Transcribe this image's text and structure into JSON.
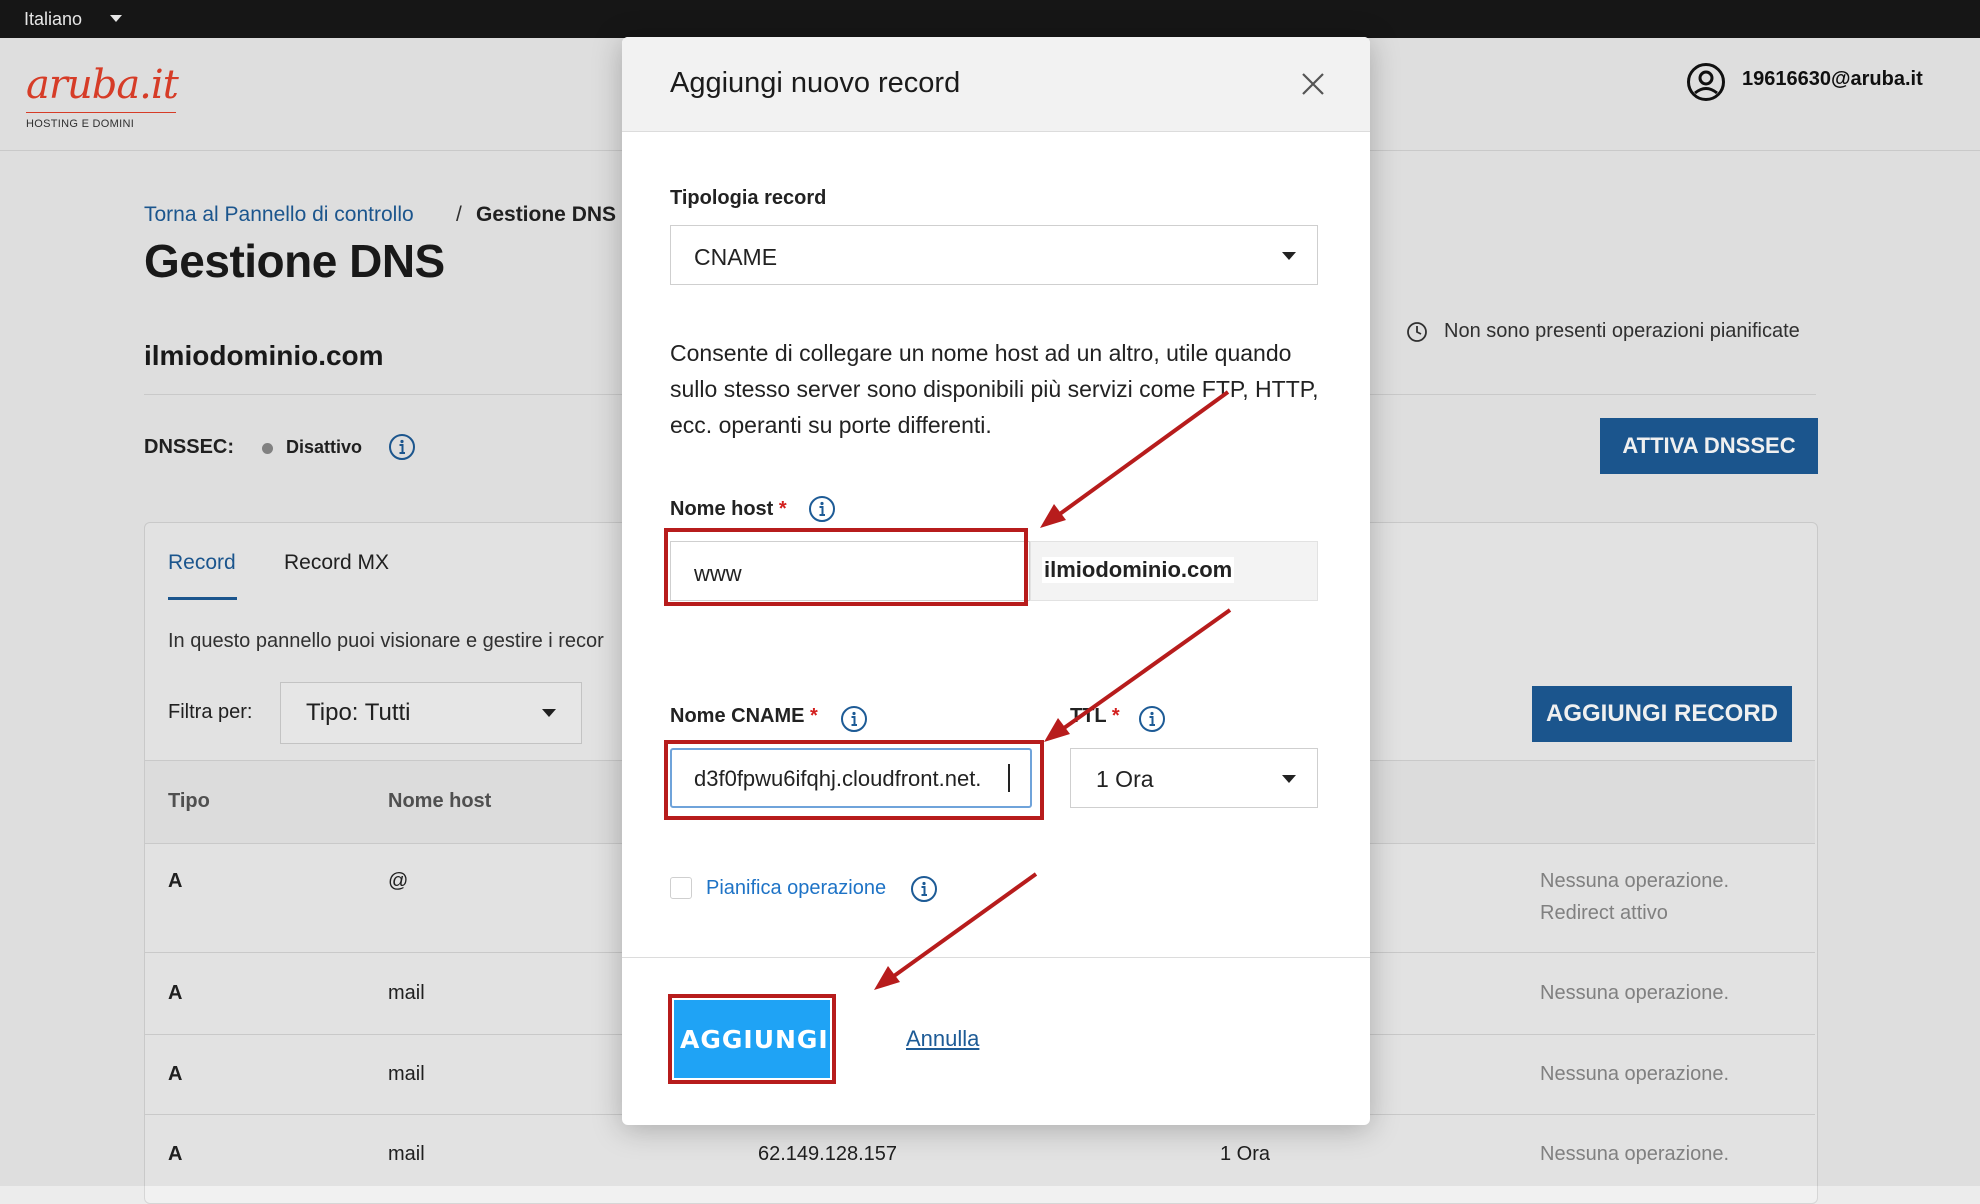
{
  "topbar": {
    "language": "Italiano"
  },
  "header": {
    "logo_text": "aruba.it",
    "logo_sub": "HOSTING E DOMINI",
    "user_email": "19616630@aruba.it"
  },
  "page": {
    "breadcrumb_link": "Torna al Pannello di controllo",
    "breadcrumb_sep": "/",
    "breadcrumb_current": "Gestione DNS",
    "title": "Gestione DNS",
    "domain": "ilmiodominio.com",
    "scheduled_text": "Non sono presenti operazioni pianificate",
    "dnssec_label": "DNSSEC:",
    "dnssec_status": "Disattivo",
    "activate_dnssec": "ATTIVA DNSSEC"
  },
  "panel": {
    "tabs": [
      {
        "label": "Record"
      },
      {
        "label": "Record MX"
      }
    ],
    "description": "In questo pannello puoi visionare e gestire i recor",
    "filter_label": "Filtra per:",
    "filter_value": "Tipo: Tutti",
    "add_record": "AGGIUNGI RECORD",
    "columns": {
      "type": "Tipo",
      "host": "Nome host"
    },
    "rows": [
      {
        "type": "A",
        "host": "@",
        "value": "",
        "ttl": "",
        "status_line1": "Nessuna operazione.",
        "status_line2": "Redirect attivo"
      },
      {
        "type": "A",
        "host": "mail",
        "value": "",
        "ttl": "",
        "status_line1": "Nessuna operazione.",
        "status_line2": ""
      },
      {
        "type": "A",
        "host": "mail",
        "value": "",
        "ttl": "",
        "status_line1": "Nessuna operazione.",
        "status_line2": ""
      },
      {
        "type": "A",
        "host": "mail",
        "value": "62.149.128.157",
        "ttl": "1 Ora",
        "status_line1": "Nessuna operazione.",
        "status_line2": ""
      }
    ]
  },
  "modal": {
    "title": "Aggiungi nuovo record",
    "type_label": "Tipologia record",
    "type_value": "CNAME",
    "type_description": "Consente di collegare un nome host ad un altro, utile quando sullo stesso server sono disponibili più servizi come FTP, HTTP, ecc. operanti su porte differenti.",
    "host_label": "Nome host",
    "host_value": "www",
    "host_suffix": "ilmiodominio.com",
    "cname_label": "Nome CNAME",
    "cname_value": "d3f0fpwu6ifqhj.cloudfront.net.",
    "ttl_label": "TTL",
    "ttl_value": "1 Ora",
    "required_mark": "*",
    "plan_label": "Pianifica operazione",
    "add_button": "AGGIUNGI",
    "cancel_link": "Annulla"
  },
  "colors": {
    "brand_red": "#e4402a",
    "primary_blue": "#1d5b96",
    "add_button_blue": "#1fa3f5",
    "annotation_red": "#b71c1c"
  }
}
